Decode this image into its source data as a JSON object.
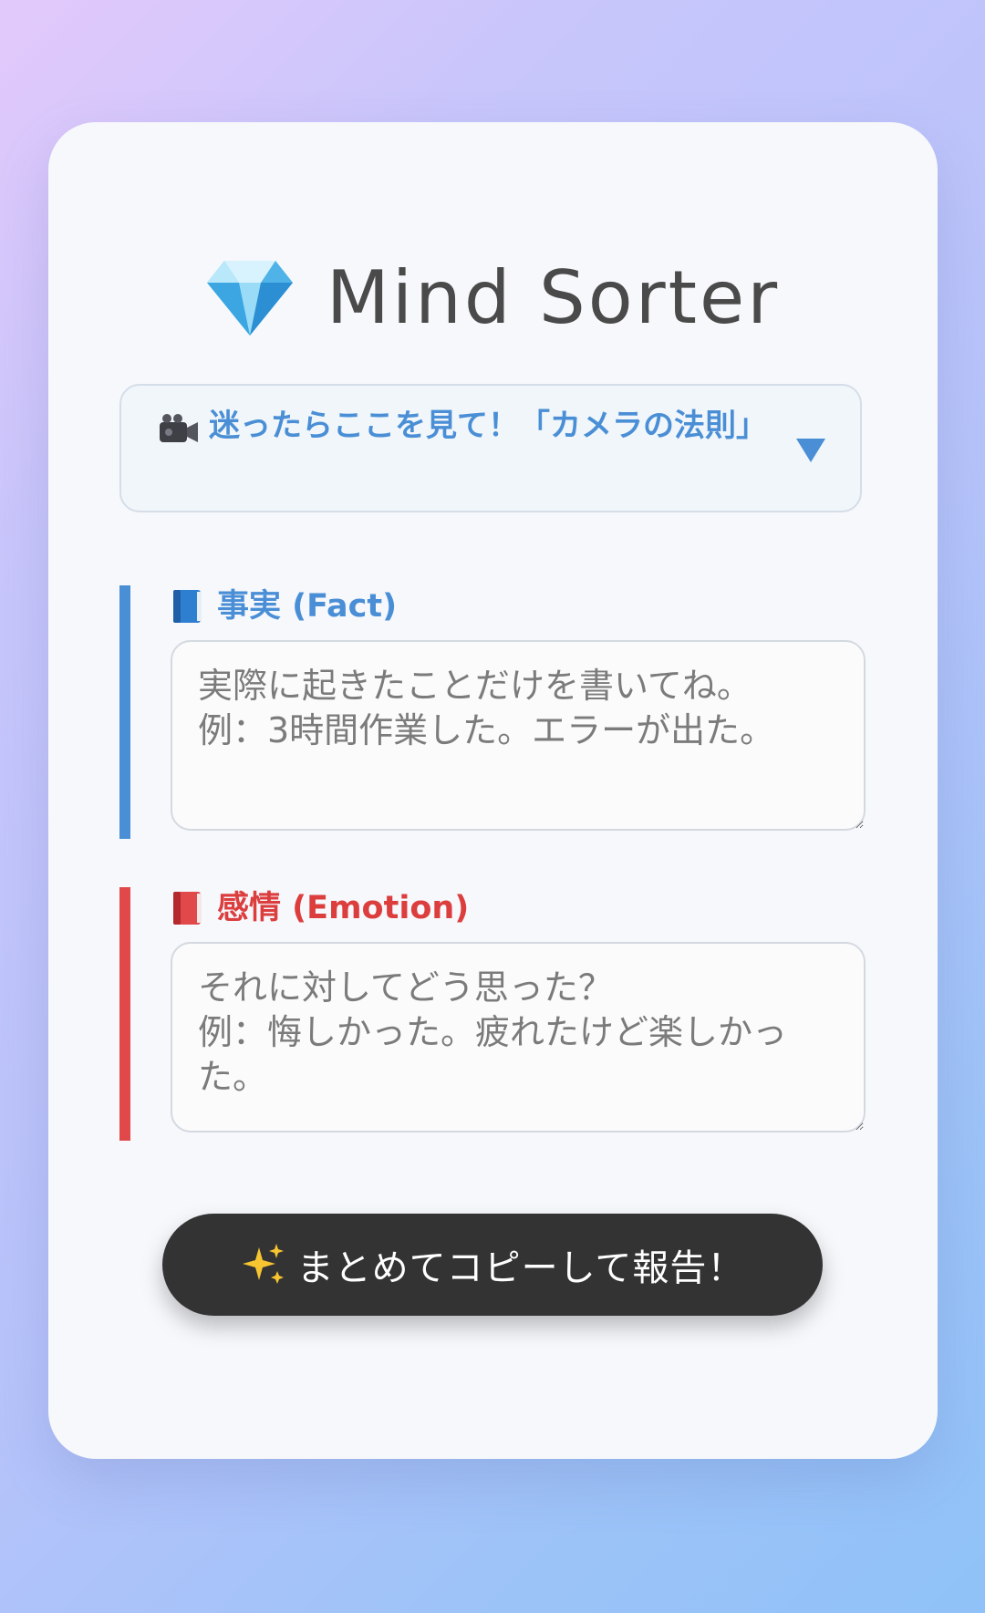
{
  "app": {
    "title": "Mind Sorter",
    "logo_icon": "gem-icon"
  },
  "tip": {
    "icon": "video-camera-icon",
    "label": "迷ったらここを見て！「カメラの法則」",
    "expander_icon": "triangle-down-icon"
  },
  "sections": {
    "fact": {
      "icon": "blue-book-icon",
      "label": "事実 (Fact)",
      "value": "",
      "placeholder": "実際に起きたことだけを書いてね。\n例：3時間作業した。エラーが出た。"
    },
    "emotion": {
      "icon": "red-book-icon",
      "label": "感情 (Emotion)",
      "value": "",
      "placeholder": "それに対してどう思った？\n例：悔しかった。疲れたけど楽しかった。"
    }
  },
  "action": {
    "icon": "sparkles-icon",
    "label": "まとめてコピーして報告！"
  },
  "colors": {
    "fact_accent": "#4a8fd6",
    "emotion_accent": "#dc3e3e",
    "button_bg": "#333333",
    "card_bg": "#f6f8fc"
  }
}
